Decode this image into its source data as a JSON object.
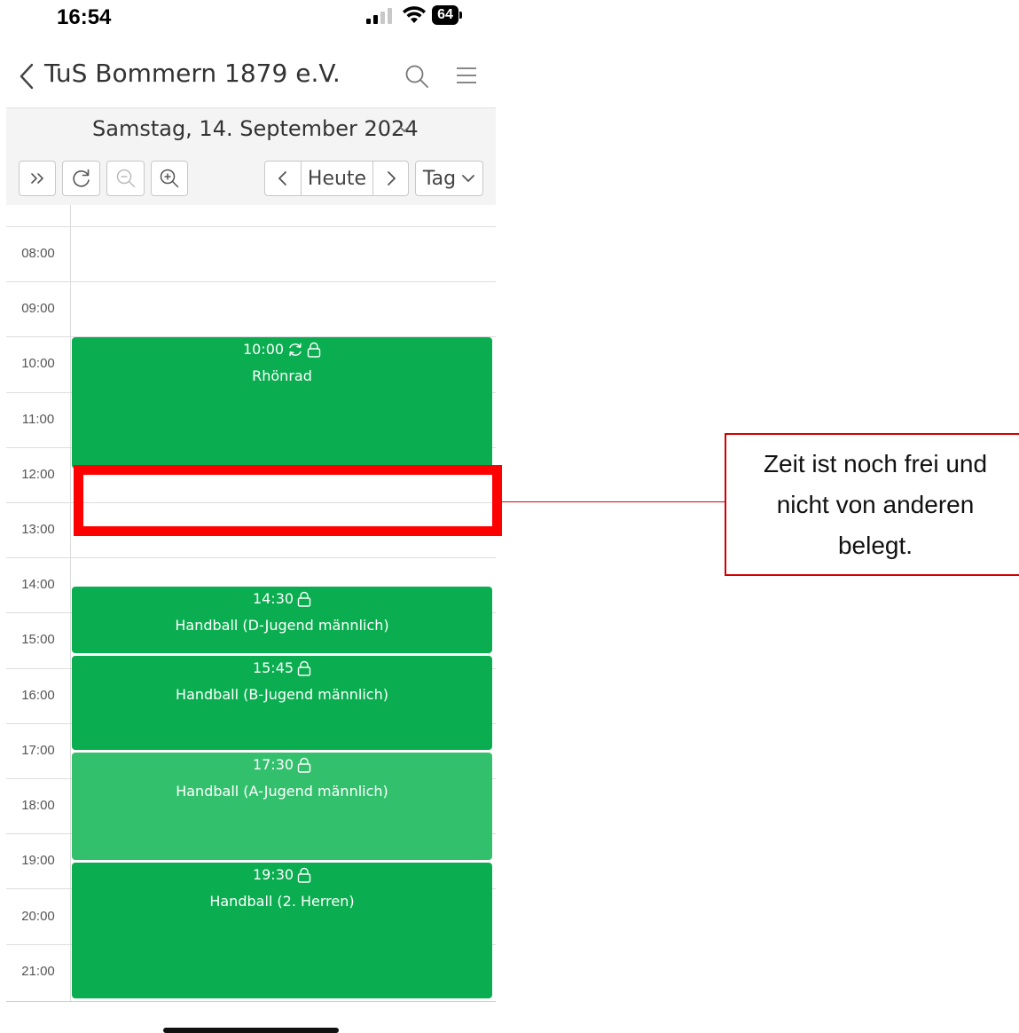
{
  "status_bar": {
    "time": "16:54",
    "battery": "64",
    "icons": [
      "signal-icon",
      "wifi-icon",
      "battery-icon"
    ]
  },
  "header": {
    "title": "TuS Bommern 1879 e.V.",
    "icons": [
      "back-chevron-icon",
      "search-icon",
      "hamburger-menu-icon"
    ]
  },
  "date_bar": {
    "label": "Samstag, 14. September 2024"
  },
  "toolbar": {
    "today_label": "Heute",
    "view_label": "Tag",
    "icons": [
      "double-chevron-right-icon",
      "refresh-icon",
      "zoom-out-icon",
      "zoom-in-icon",
      "chevron-left-icon",
      "chevron-right-icon",
      "chevron-down-icon"
    ]
  },
  "calendar": {
    "hours": [
      "08:00",
      "09:00",
      "10:00",
      "11:00",
      "12:00",
      "13:00",
      "14:00",
      "15:00",
      "16:00",
      "17:00",
      "18:00",
      "19:00",
      "20:00",
      "21:00"
    ],
    "events": [
      {
        "time": "10:00",
        "title": "Rhönrad",
        "icons": [
          "repeat-icon",
          "lock-icon"
        ]
      },
      {
        "time": "14:30",
        "title": "Handball (D-Jugend männlich)",
        "icons": [
          "lock-icon"
        ]
      },
      {
        "time": "15:45",
        "title": "Handball (B-Jugend männlich)",
        "icons": [
          "lock-icon"
        ]
      },
      {
        "time": "17:30",
        "title": "Handball (A-Jugend männlich)",
        "icons": [
          "lock-icon"
        ]
      },
      {
        "time": "19:30",
        "title": "Handball (2. Herren)",
        "icons": [
          "lock-icon"
        ]
      }
    ]
  },
  "annotation": {
    "lines": [
      "Zeit ist noch frei und",
      "nicht von anderen",
      "belegt."
    ],
    "color": "#ff0000"
  },
  "colors": {
    "event_green": "#0aad4f",
    "event_green_light": "#33c06d"
  }
}
